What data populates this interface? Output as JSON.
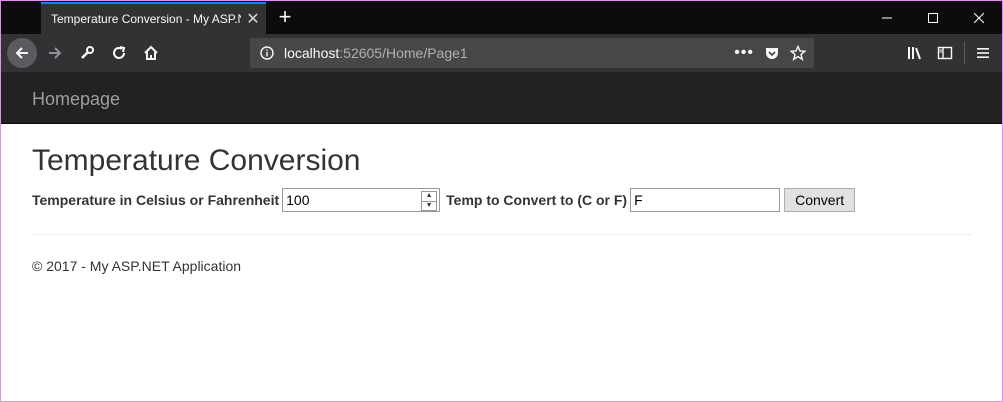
{
  "browser": {
    "tab_title": "Temperature Conversion - My ASP.NET Application",
    "url_host": "localhost",
    "url_path": ":52605/Home/Page1",
    "icons": [
      "back-icon",
      "forward-icon",
      "wrench-icon",
      "reload-icon",
      "home-icon",
      "info-icon",
      "more-icon",
      "pocket-icon",
      "bookmark-star-icon",
      "library-icon",
      "sidebar-icon",
      "menu-icon"
    ]
  },
  "site": {
    "brand": "Homepage"
  },
  "page": {
    "title": "Temperature Conversion",
    "temp_label": "Temperature in Celsius or Fahrenheit",
    "temp_value": "100",
    "target_label": "Temp to Convert to (C or F)",
    "target_value": "F",
    "convert_label": "Convert"
  },
  "footer": {
    "text": "© 2017 - My ASP.NET Application"
  }
}
